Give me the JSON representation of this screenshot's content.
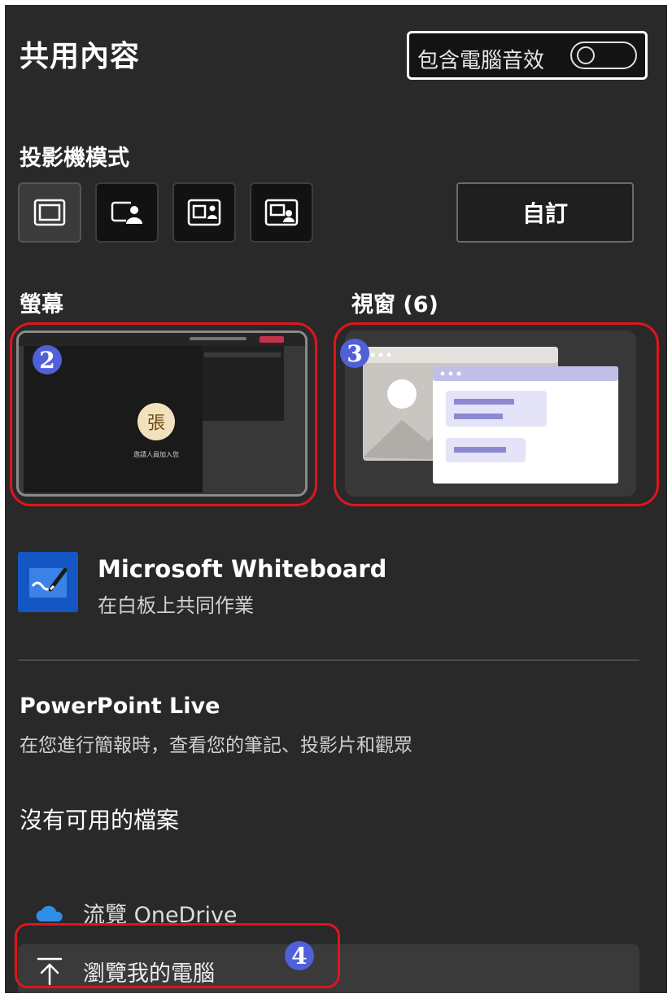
{
  "header": {
    "title": "共用內容",
    "audio_label": "包含電腦音效"
  },
  "presenter_mode": {
    "heading": "投影機模式",
    "modes": [
      {
        "icon": "content-only-icon",
        "selected": true
      },
      {
        "icon": "standout-icon",
        "selected": false
      },
      {
        "icon": "side-by-side-icon",
        "selected": false
      },
      {
        "icon": "reporter-icon",
        "selected": false
      }
    ],
    "custom_label": "自訂"
  },
  "screen": {
    "heading": "螢幕",
    "avatar_char": "張",
    "caption": "邀請人員加入您"
  },
  "window": {
    "heading": "視窗 (6)"
  },
  "annotations": {
    "screen": "2",
    "window": "3",
    "browse_pc": "4"
  },
  "whiteboard": {
    "title": "Microsoft Whiteboard",
    "subtitle": "在白板上共同作業"
  },
  "powerpoint": {
    "title": "PowerPoint Live",
    "subtitle": "在您進行簡報時，查看您的筆記、投影片和觀眾",
    "no_files": "沒有可用的檔案"
  },
  "browse": {
    "onedrive": "流覽 OneDrive",
    "my_computer": "瀏覽我的電腦"
  },
  "colors": {
    "panel": "#292929",
    "annotation_ring": "#e2141c",
    "annotation_badge": "#5060d8",
    "whiteboard_blue": "#1457c4",
    "onedrive_blue": "#2f8ee8"
  }
}
